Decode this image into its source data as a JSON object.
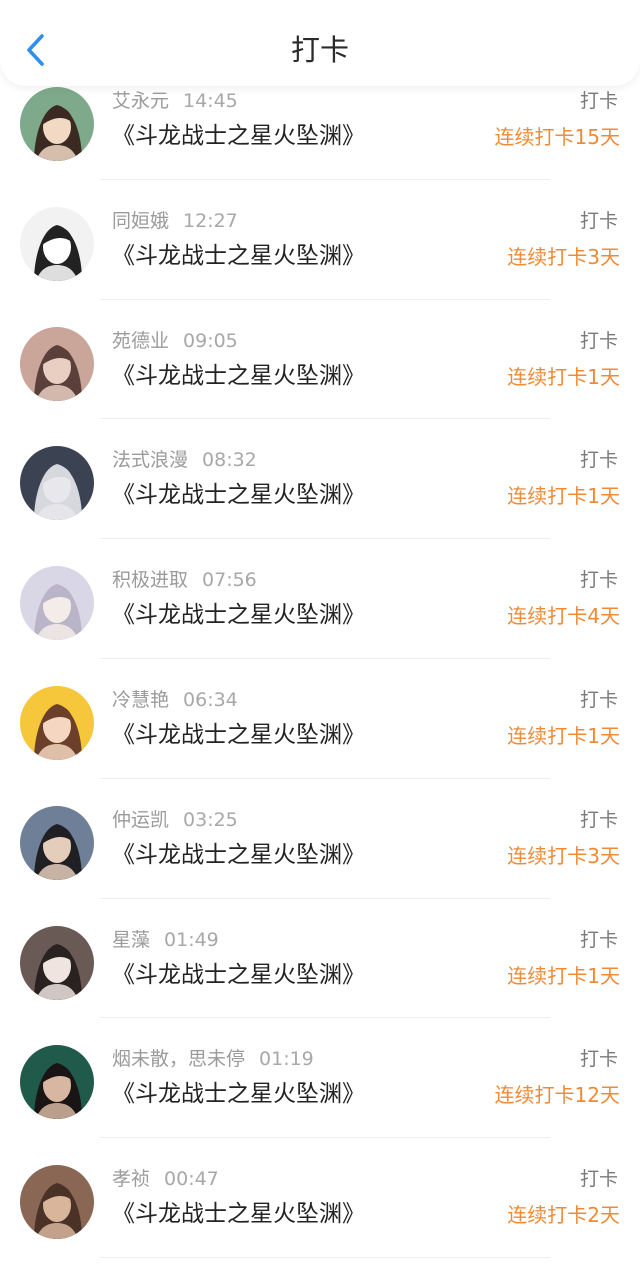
{
  "header": {
    "title": "打卡"
  },
  "colors": {
    "accent": "#2e8ff0",
    "streak": "#f08a35"
  },
  "items": [
    {
      "name": "艾永元",
      "time": "14:45",
      "book": "《斗龙战士之星火坠渊》",
      "tag": "打卡",
      "streak": "连续打卡15天"
    },
    {
      "name": "同姮娥",
      "time": "12:27",
      "book": "《斗龙战士之星火坠渊》",
      "tag": "打卡",
      "streak": "连续打卡3天"
    },
    {
      "name": "苑德业",
      "time": "09:05",
      "book": "《斗龙战士之星火坠渊》",
      "tag": "打卡",
      "streak": "连续打卡1天"
    },
    {
      "name": "法式浪漫",
      "time": "08:32",
      "book": "《斗龙战士之星火坠渊》",
      "tag": "打卡",
      "streak": "连续打卡1天"
    },
    {
      "name": "积极进取",
      "time": "07:56",
      "book": "《斗龙战士之星火坠渊》",
      "tag": "打卡",
      "streak": "连续打卡4天"
    },
    {
      "name": "冷慧艳",
      "time": "06:34",
      "book": "《斗龙战士之星火坠渊》",
      "tag": "打卡",
      "streak": "连续打卡1天"
    },
    {
      "name": "仲运凯",
      "time": "03:25",
      "book": "《斗龙战士之星火坠渊》",
      "tag": "打卡",
      "streak": "连续打卡3天"
    },
    {
      "name": "星藻",
      "time": "01:49",
      "book": "《斗龙战士之星火坠渊》",
      "tag": "打卡",
      "streak": "连续打卡1天"
    },
    {
      "name": "烟未散，思未停",
      "time": "01:19",
      "book": "《斗龙战士之星火坠渊》",
      "tag": "打卡",
      "streak": "连续打卡12天"
    },
    {
      "name": "孝祯",
      "time": "00:47",
      "book": "《斗龙战士之星火坠渊》",
      "tag": "打卡",
      "streak": "连续打卡2天"
    }
  ],
  "avatars": [
    {
      "icon": "user-avatar-icon",
      "bg": "#7fa98b",
      "face": "#f1d9c4",
      "hair": "#3a2a22"
    },
    {
      "icon": "user-avatar-icon",
      "bg": "#f2f2f2",
      "face": "#ffffff",
      "hair": "#222222"
    },
    {
      "icon": "user-avatar-icon",
      "bg": "#c9a59a",
      "face": "#e9cfc2",
      "hair": "#5a3f3a"
    },
    {
      "icon": "user-avatar-icon",
      "bg": "#3b4252",
      "face": "#e8e8ec",
      "hair": "#d7d7de"
    },
    {
      "icon": "user-avatar-icon",
      "bg": "#d9d6e6",
      "face": "#f4ece8",
      "hair": "#b9b4c8"
    },
    {
      "icon": "user-avatar-icon",
      "bg": "#f6c73a",
      "face": "#f5d6c0",
      "hair": "#6b3f2a"
    },
    {
      "icon": "user-avatar-icon",
      "bg": "#6e7f97",
      "face": "#e5cdbb",
      "hair": "#1f1f24"
    },
    {
      "icon": "user-avatar-icon",
      "bg": "#6a5a55",
      "face": "#efe4df",
      "hair": "#2a2220"
    },
    {
      "icon": "user-avatar-icon",
      "bg": "#1f5a4a",
      "face": "#d7b7a2",
      "hair": "#1b1414"
    },
    {
      "icon": "user-avatar-icon",
      "bg": "#8a6654",
      "face": "#d9b59c",
      "hair": "#4b3227"
    }
  ]
}
